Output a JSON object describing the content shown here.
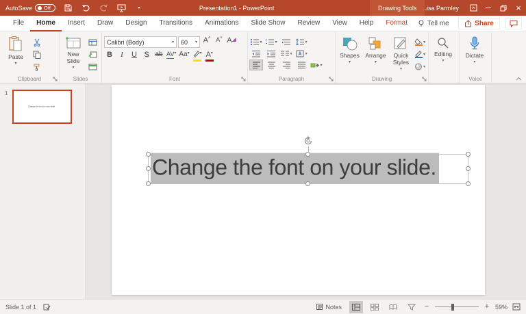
{
  "colors": {
    "brand": "#B7472A",
    "brand-light": "#C25536",
    "accent": "#C8401F",
    "selection": "#BCBCBC",
    "dictate-blue": "#2B7CD3",
    "bar-yellow": "#F7E200",
    "bar-red": "#C00000"
  },
  "titlebar": {
    "autosave_label": "AutoSave",
    "autosave_state": "Off",
    "title": "Presentation1 - PowerPoint",
    "contextual_tab_group": "Drawing Tools",
    "user_name": "Lisa Parmley"
  },
  "tabs": {
    "items": [
      "File",
      "Home",
      "Insert",
      "Draw",
      "Design",
      "Transitions",
      "Animations",
      "Slide Show",
      "Review",
      "View",
      "Help"
    ],
    "format_tab": "Format",
    "tell_me": "Tell me",
    "share": "Share"
  },
  "ribbon": {
    "clipboard": {
      "label": "Clipboard",
      "paste": "Paste"
    },
    "slides": {
      "label": "Slides",
      "new_slide": "New Slide"
    },
    "font": {
      "label": "Font",
      "font_name": "Calibri (Body)",
      "font_size": "60",
      "grow_font": "A",
      "shrink_font": "A",
      "clear_format": "A",
      "bold": "B",
      "italic": "I",
      "underline": "U",
      "shadow": "S",
      "strikethrough": "ab",
      "char_spacing": "AV",
      "change_case": "Aa",
      "font_color": "A"
    },
    "paragraph": {
      "label": "Paragraph"
    },
    "drawing": {
      "label": "Drawing",
      "shapes": "Shapes",
      "arrange": "Arrange",
      "quick_styles": "Quick Styles"
    },
    "editing": {
      "label": "Editing"
    },
    "voice": {
      "label": "Voice",
      "dictate": "Dictate"
    }
  },
  "thumbnail_panel": {
    "slide_number": "1",
    "thumbnail_text": "Change the font on your slide."
  },
  "slide": {
    "text": "Change the font on your slide."
  },
  "statusbar": {
    "slide_indicator": "Slide 1 of 1",
    "notes_label": "Notes",
    "zoom_level": "59%"
  }
}
